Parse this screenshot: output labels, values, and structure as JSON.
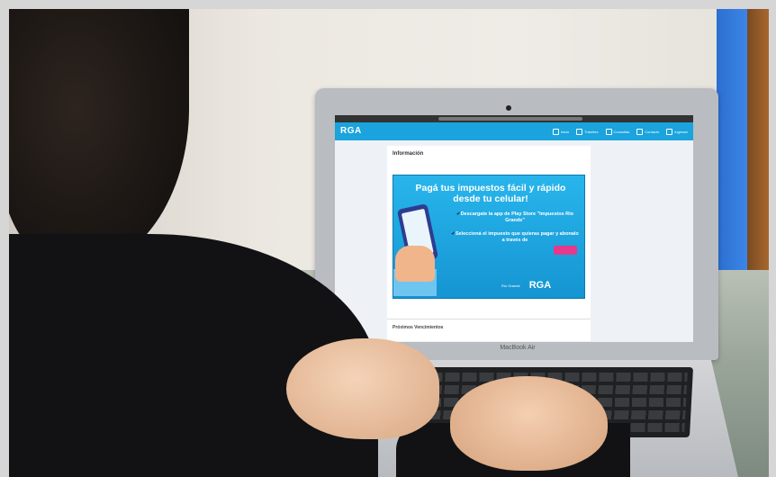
{
  "site": {
    "logo": "RGA",
    "nav": [
      "Inicio",
      "Trámites",
      "Consultas",
      "Contacto",
      "Ingresar"
    ],
    "section_title": "Información",
    "section_text": "",
    "side_links": [
      "",
      "",
      ""
    ],
    "next_section_title": "Próximos Vencimientos"
  },
  "banner": {
    "title": "Pagá tus impuestos fácil y rápido desde tu celular!",
    "step1": "Descargate la app de Play Store \"Impuestos Río Grande\"",
    "step2": "Seleccioná el impuesto que quieras pagar y abonalo a través de",
    "footer_logo_left": "Río Grande",
    "footer_logo_right": "RGA"
  },
  "laptop": {
    "brand": "MacBook Air"
  },
  "colors": {
    "site_header": "#1aa3dd",
    "banner": "#1ea9e3",
    "accent_badge": "#e6398c"
  }
}
